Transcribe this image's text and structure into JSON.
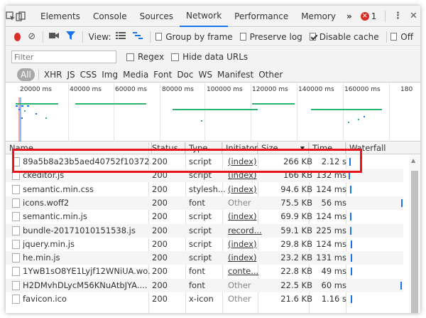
{
  "tabs": [
    {
      "label": "Elements"
    },
    {
      "label": "Console"
    },
    {
      "label": "Sources"
    },
    {
      "label": "Network",
      "active": true
    },
    {
      "label": "Performance"
    },
    {
      "label": "Memory"
    }
  ],
  "more_tabs": "»",
  "error_count": "1",
  "toolbar": {
    "view_label": "View:",
    "group_by_frame": "Group by frame",
    "preserve_log": "Preserve log",
    "disable_cache": "Disable cache",
    "offline": "Off"
  },
  "filter": {
    "placeholder": "Filter",
    "regex": "Regex",
    "hide_data_urls": "Hide data URLs"
  },
  "types": [
    "All",
    "XHR",
    "JS",
    "CSS",
    "Img",
    "Media",
    "Font",
    "Doc",
    "WS",
    "Manifest",
    "Other"
  ],
  "overview_ticks": [
    "20000 ms",
    "40000 ms",
    "60000 ms",
    "80000 ms",
    "100000 ms",
    "120000 ms",
    "140000 ms",
    "160000 ms",
    "180"
  ],
  "columns": {
    "name": "Name",
    "status": "Status",
    "type": "Type",
    "initiator": "Initiator",
    "size": "Size",
    "time": "Time",
    "waterfall": "Waterfall"
  },
  "rows": [
    {
      "name": "89a5b8a23b5aed40752f10372...",
      "status": "200",
      "type": "script",
      "initiator": "(index)",
      "size": "266 KB",
      "time": "2.12 s"
    },
    {
      "name": "ckeditor.js",
      "status": "200",
      "type": "script",
      "initiator": "(index)",
      "size": "166 KB",
      "time": "132 ms"
    },
    {
      "name": "semantic.min.css",
      "status": "200",
      "type": "stylesh...",
      "initiator": "(index)",
      "size": "94.6 KB",
      "time": "124 ms"
    },
    {
      "name": "icons.woff2",
      "status": "200",
      "type": "font",
      "initiator": "Other",
      "size": "75.5 KB",
      "time": "56 ms"
    },
    {
      "name": "semantic.min.js",
      "status": "200",
      "type": "script",
      "initiator": "(index)",
      "size": "69.9 KB",
      "time": "124 ms"
    },
    {
      "name": "bundle-20171010151538.js",
      "status": "200",
      "type": "script",
      "initiator": "record...",
      "size": "59.1 KB",
      "time": "225 ms"
    },
    {
      "name": "jquery.min.js",
      "status": "200",
      "type": "script",
      "initiator": "(index)",
      "size": "29.8 KB",
      "time": "124 ms"
    },
    {
      "name": "he.min.js",
      "status": "200",
      "type": "script",
      "initiator": "(index)",
      "size": "23.2 KB",
      "time": "131 ms"
    },
    {
      "name": "1YwB1sO8YE1Lyjf12WNiUA.wo...",
      "status": "200",
      "type": "font",
      "initiator": "conte...",
      "size": "22.8 KB",
      "time": "49 ms"
    },
    {
      "name": "H2DMvhDLycM56KNuAtbJYA....",
      "status": "200",
      "type": "font",
      "initiator": "Other",
      "size": "22.5 KB",
      "time": "60 ms"
    },
    {
      "name": "favicon.ico",
      "status": "200",
      "type": "x-icon",
      "initiator": "Other",
      "size": "21.6 KB",
      "time": "1.16 s"
    }
  ],
  "colors": {
    "accent": "#1a73e8",
    "record": "#d93025",
    "highlight": "#e8141b"
  }
}
